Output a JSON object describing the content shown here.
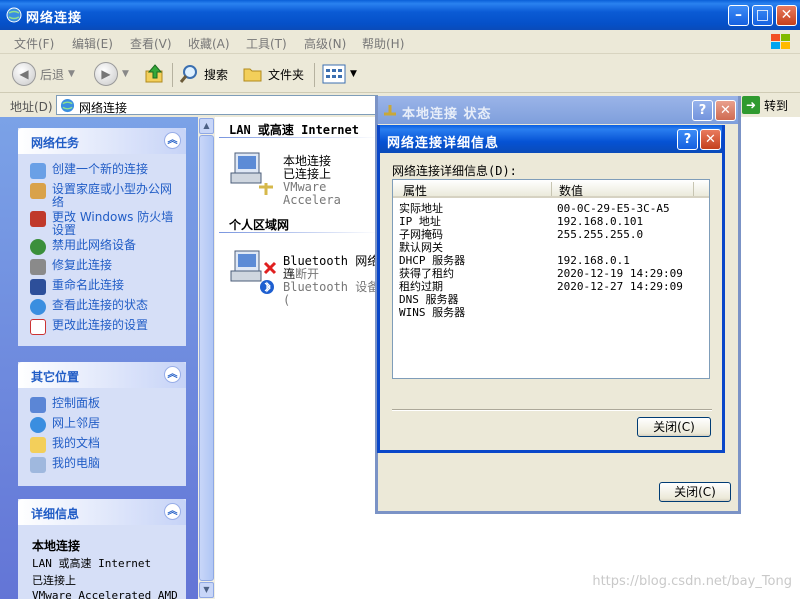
{
  "window": {
    "title": "网络连接"
  },
  "menu": [
    "文件(F)",
    "编辑(E)",
    "查看(V)",
    "收藏(A)",
    "工具(T)",
    "高级(N)",
    "帮助(H)"
  ],
  "toolbar": {
    "back": "后退",
    "search": "搜索",
    "folders": "文件夹"
  },
  "address": {
    "label": "地址(D)",
    "value": "网络连接",
    "go": "转到"
  },
  "tasks_panel": {
    "title": "网络任务",
    "items": [
      "创建一个新的连接",
      "设置家庭或小型办公网络",
      "更改 Windows 防火墙设置",
      "禁用此网络设备",
      "修复此连接",
      "重命名此连接",
      "查看此连接的状态",
      "更改此连接的设置"
    ]
  },
  "places_panel": {
    "title": "其它位置",
    "items": [
      "控制面板",
      "网上邻居",
      "我的文档",
      "我的电脑"
    ]
  },
  "details_panel": {
    "title": "详细信息",
    "name": "本地连接",
    "line1": "LAN 或高速 Internet",
    "line2": "已连接上",
    "line3": "VMware Accelerated AMD"
  },
  "content": {
    "group_lan": "LAN 或高速 Internet",
    "group_pan": "个人区域网",
    "lan_item": {
      "name": "本地连接",
      "status": "已连接上",
      "device": "VMware Accelera"
    },
    "bt_item": {
      "name": "Bluetooth 网络连",
      "status": "已断开",
      "device": "Bluetooth 设备 ("
    }
  },
  "status_dialog": {
    "title": "本地连接 状态",
    "close": "关闭(C)"
  },
  "details_dialog": {
    "title": "网络连接详细信息",
    "list_label": "网络连接详细信息(D):",
    "col_property": "属性",
    "col_value": "数值",
    "rows": [
      {
        "k": "实际地址",
        "v": "00-0C-29-E5-3C-A5"
      },
      {
        "k": "IP 地址",
        "v": "192.168.0.101"
      },
      {
        "k": "子网掩码",
        "v": "255.255.255.0"
      },
      {
        "k": "默认网关",
        "v": ""
      },
      {
        "k": "DHCP 服务器",
        "v": "192.168.0.1"
      },
      {
        "k": "获得了租约",
        "v": "2020-12-19 14:29:09"
      },
      {
        "k": "租约过期",
        "v": "2020-12-27 14:29:09"
      },
      {
        "k": "DNS 服务器",
        "v": ""
      },
      {
        "k": "WINS 服务器",
        "v": ""
      }
    ],
    "close": "关闭(C)"
  },
  "watermark": "https://blog.csdn.net/bay_Tong"
}
